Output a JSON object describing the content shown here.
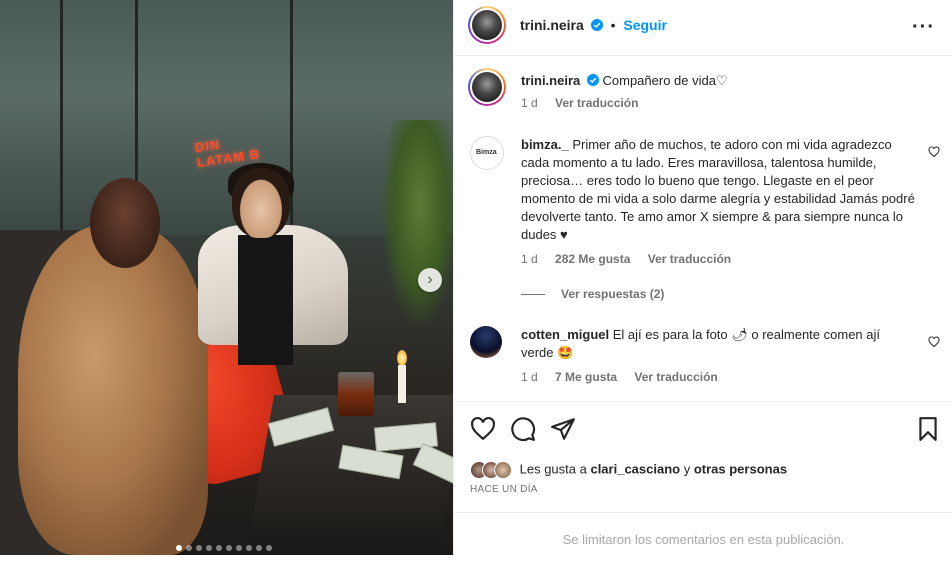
{
  "header": {
    "username": "trini.neira",
    "separator": "•",
    "follow_label": "Seguir",
    "more_label": "···"
  },
  "caption": {
    "username": "trini.neira",
    "text": "Compañero de vida♡",
    "time": "1 d",
    "translate_label": "Ver traducción"
  },
  "comments": [
    {
      "username": "bimza._",
      "text": "Primer año de muchos, te adoro con mi vida agradezco cada momento a tu lado. Eres maravillosa, talentosa humilde, preciosa… eres todo lo bueno que tengo. Llegaste en el peor momento de mi vida a solo darme alegría y estabilidad Jamás podré devolverte tanto. Te amo amor X siempre & para siempre nunca lo dudes ♥",
      "time": "1 d",
      "likes": "282 Me gusta",
      "translate_label": "Ver traducción",
      "replies_label": "Ver respuestas (2)"
    },
    {
      "username": "cotten_miguel",
      "text": "El ají es para la foto 🌶 o realmente comen ají verde 🤩",
      "time": "1 d",
      "likes": "7 Me gusta",
      "translate_label": "Ver traducción"
    }
  ],
  "likes_bar": {
    "prefix": "Les gusta a",
    "user": "clari_casciano",
    "joiner": "y",
    "others": "otras personas",
    "when": "HACE UN DÍA"
  },
  "footer": {
    "text": "Se limitaron los comentarios en esta publicación."
  },
  "image": {
    "neon_text": "DIN LATAM B",
    "carousel_total": 10,
    "carousel_active": 1,
    "next_label": "›"
  },
  "colors": {
    "accent": "#0095f6",
    "verified": "#0095f6",
    "muted": "#737373"
  },
  "icons": [
    "verified-icon",
    "more-icon",
    "heart-icon",
    "comment-icon",
    "share-icon",
    "bookmark-icon",
    "chevron-right-icon"
  ]
}
